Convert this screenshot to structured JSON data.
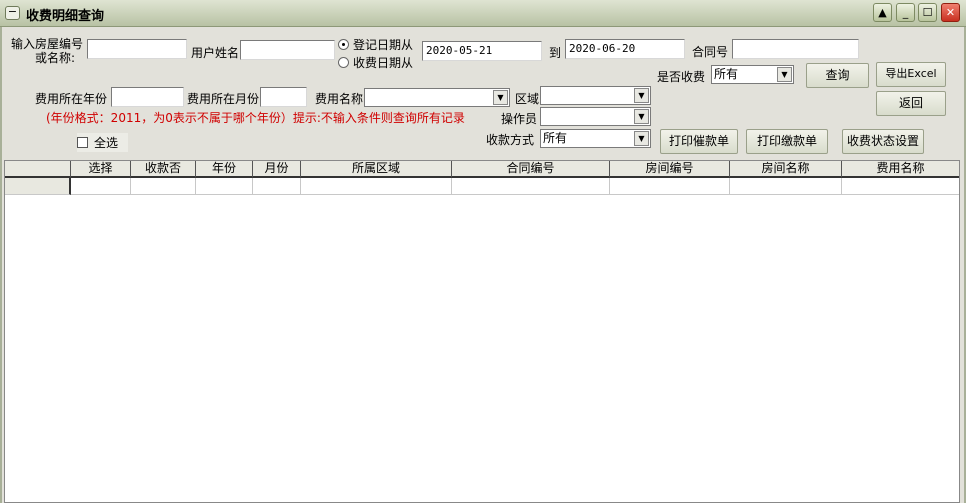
{
  "window": {
    "title": "收费明细查询",
    "controls": [
      "▲",
      "_",
      "☐",
      "✕"
    ]
  },
  "form": {
    "house_label_1": "输入房屋编号",
    "house_label_2": "或名称:",
    "house_value": "",
    "user_name_label": "用户姓名",
    "user_name_value": "",
    "radio_register": "登记日期从",
    "radio_charge": "收费日期从",
    "date_from": "2020-05-21",
    "to_label": "到",
    "date_to": "2020-06-20",
    "contract_label": "合同号",
    "contract_value": "",
    "charged_label": "是否收费",
    "charged_value": "所有",
    "year_label": "费用所在年份",
    "year_value": "",
    "month_label": "费用所在月份",
    "month_value": "",
    "fee_name_label": "费用名称",
    "fee_name_value": "",
    "area_label": "区域",
    "area_value": "",
    "operator_label": "操作员",
    "operator_value": "",
    "payment_label": "收款方式",
    "payment_value": "所有",
    "hint": "(年份格式：2011，为0表示不属于哪个年份）提示:不输入条件则查询所有记录",
    "select_all": "全选"
  },
  "buttons": {
    "query": "查询",
    "export": "导出Excel",
    "back": "返回",
    "print_reminder": "打印催款单",
    "print_payment": "打印缴款单",
    "status_setting": "收费状态设置"
  },
  "grid": {
    "columns": [
      "选择",
      "收款否",
      "年份",
      "月份",
      "所属区域",
      "合同编号",
      "房间编号",
      "房间名称",
      "费用名称"
    ]
  }
}
